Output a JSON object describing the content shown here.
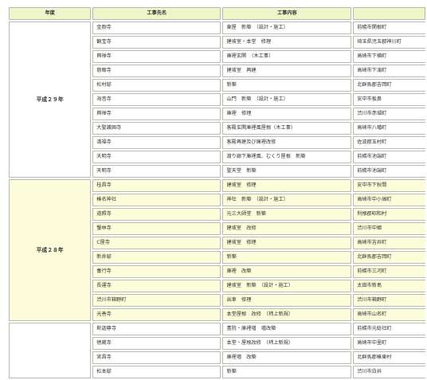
{
  "header": {
    "year": "年度",
    "client": "工事先名",
    "content": "工事内容",
    "location": ""
  },
  "groups": [
    {
      "year": "平成２９年",
      "rows": [
        [
          "金剛寺",
          "東屋　新築　（設計・施工）",
          "前橋市関根町"
        ],
        [
          "観宝寺",
          "建坡室・本堂　修理",
          "埼玉県児玉郡神川町"
        ],
        [
          "興禅寺",
          "庫裡玄関　（木工事）",
          "高崎市下横町"
        ],
        [
          "慈眼寺",
          "建坡室　再建",
          "高崎市下滝町"
        ],
        [
          "松村邸",
          "新築",
          "北群馬郡吉岡町"
        ],
        [
          "海音寺",
          "山門　新築　（設計・施工）",
          "安中市板鼻"
        ],
        [
          "興禅寺",
          "庫裡　修理",
          "渋川市赤城町"
        ],
        [
          "大聖護国寺",
          "客殿玄関庫裡風屋根（木工事）",
          "高崎市八幡町"
        ],
        [
          "満福寺",
          "客殿再建及び庫裡改修",
          "佐波郡玉村町"
        ],
        [
          "天明寺",
          "渡り廊下庫裡風、むくり屋根　新築",
          "前橋市池端町"
        ],
        [
          "天明寺",
          "聖天堂　新築",
          "前橋市池端町"
        ]
      ]
    },
    {
      "year": "平成２８年",
      "rows": [
        [
          "桂昌寺",
          "建坡室　修理",
          "安中市下秋間"
        ],
        [
          "榛名神社",
          "神社　新築　（設計・施工）",
          "高崎市中小塙町"
        ],
        [
          "道照寺",
          "元三大師堂　新築",
          "利根郡昭和村"
        ],
        [
          "蟹林寺",
          "建坡室　改修",
          "渋川市中郷"
        ],
        [
          "C屋寺",
          "建坡室　修理",
          "高崎市吉井町"
        ],
        [
          "新井邸",
          "新築",
          "北群馬郡吉岡町"
        ],
        [
          "養行寺",
          "庫裡　改築",
          "前橋市三河町"
        ],
        [
          "長運寺",
          "建坡室　新築　（設計・施工）",
          "太田市新島"
        ],
        [
          "渋川市箱野町",
          "出車　修理",
          "渋川市箱野町"
        ],
        [
          "光善寺",
          "本堂屋根　改修　（杮上新規）",
          "高崎市山名町"
        ]
      ]
    },
    {
      "year": "",
      "rows": [
        [
          "釈迦尊寺",
          "書院・庫裡増　増改築",
          "前橋市元総社町"
        ],
        [
          "徳蔵寺",
          "本堂・屋根改修　（杮上新規）",
          "高崎市中里町"
        ],
        [
          "宮昌寺",
          "庫裡増　改築",
          "北群馬郡榛東村"
        ],
        [
          "松本邸",
          "新築",
          "渋川市白井"
        ]
      ]
    }
  ]
}
